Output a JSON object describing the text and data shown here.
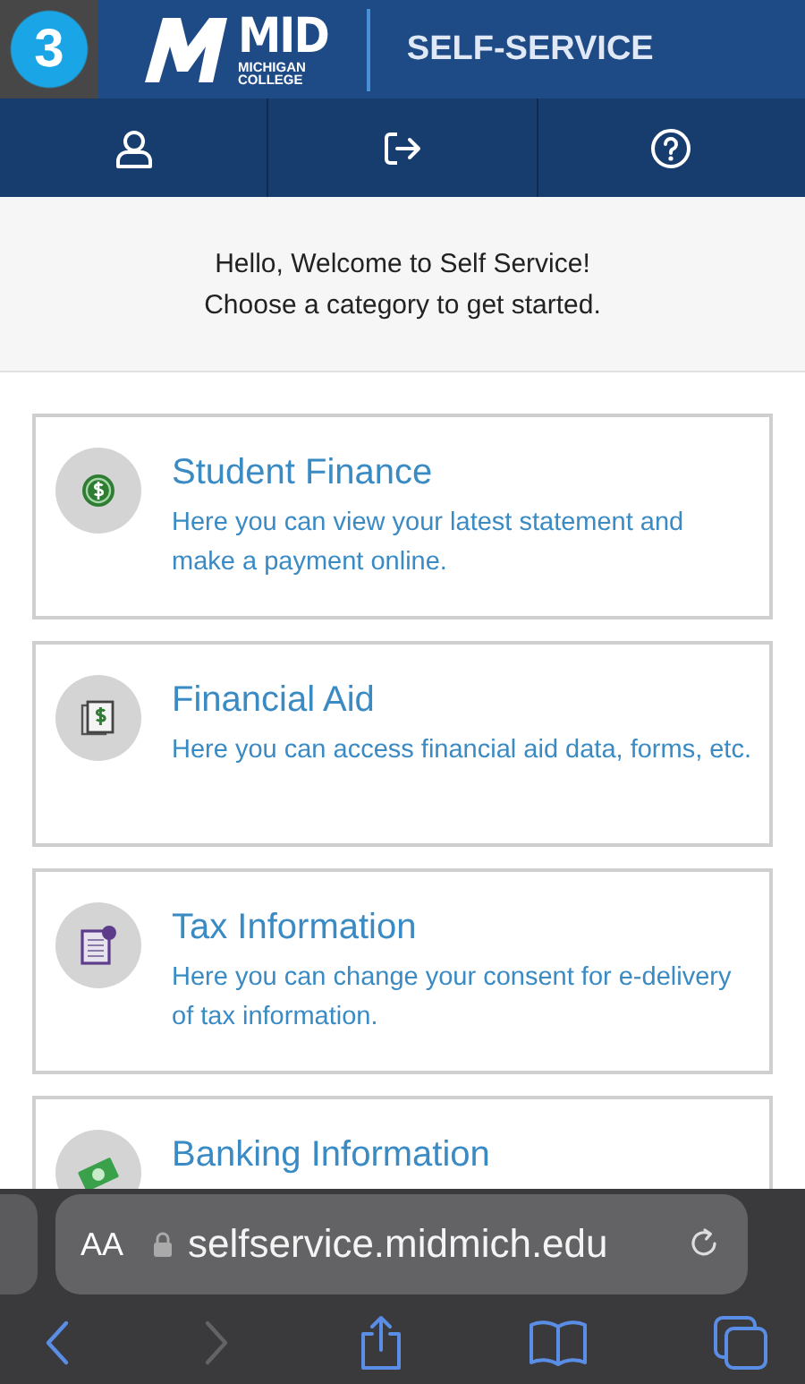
{
  "step_badge": "3",
  "header": {
    "logo_main": "MID",
    "logo_sub": [
      "MICHIGAN",
      "COLLEGE"
    ],
    "title": "SELF-SERVICE"
  },
  "nav": [
    {
      "kind": "profile"
    },
    {
      "kind": "signout"
    },
    {
      "kind": "help"
    }
  ],
  "welcome": [
    "Hello, Welcome to Self Service!",
    "Choose a category to get started."
  ],
  "cards": [
    {
      "kind": "coin",
      "title": "Student Finance",
      "description": "Here you can view your latest statement and make a payment online."
    },
    {
      "kind": "aid",
      "title": "Financial Aid",
      "description": "Here you can access financial aid data, forms, etc."
    },
    {
      "kind": "tax",
      "title": "Tax Information",
      "description": "Here you can change your consent for e-delivery of tax information."
    },
    {
      "kind": "bank",
      "title": "Banking Information"
    }
  ],
  "browser": {
    "text_size": "AA",
    "url": "selfservice.midmich.edu",
    "back_disabled": false,
    "forward_disabled": true
  }
}
